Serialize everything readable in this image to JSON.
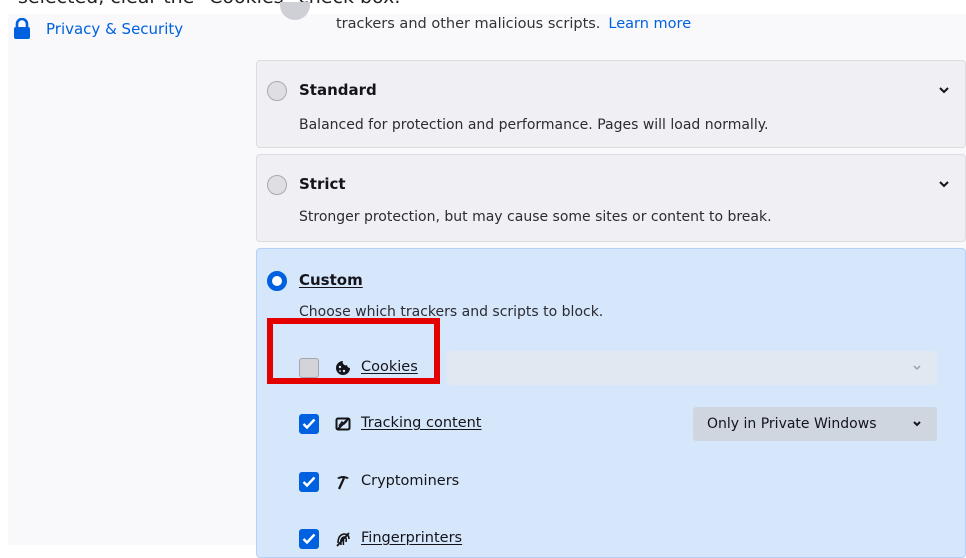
{
  "caption": "selected, clear the \"Cookies\" check box.",
  "sidebar": {
    "items": [
      {
        "label": "Privacy & Security",
        "icon": "lock-icon"
      }
    ]
  },
  "intro": {
    "text": "trackers and other malicious scripts.",
    "link": "Learn more"
  },
  "options": {
    "standard": {
      "title": "Standard",
      "description": "Balanced for protection and performance. Pages will load normally.",
      "checked": false
    },
    "strict": {
      "title": "Strict",
      "description": "Stronger protection, but may cause some sites or content to break.",
      "checked": false
    },
    "custom": {
      "title": "Custom",
      "description": "Choose which trackers and scripts to block.",
      "checked": true
    }
  },
  "custom_items": {
    "cookies": {
      "label": "Cookies",
      "checked": false,
      "icon": "cookie-icon"
    },
    "tracking": {
      "label": "Tracking content",
      "checked": true,
      "icon": "tracking-icon",
      "select_value": "Only in Private Windows"
    },
    "cryptominers": {
      "label": "Cryptominers",
      "checked": true,
      "icon": "cryptominer-icon"
    },
    "fingerprinters": {
      "label": "Fingerprinters",
      "checked": true,
      "icon": "fingerprint-icon"
    }
  },
  "colors": {
    "accent": "#0061e0",
    "highlight": "#e50000",
    "custom_bg": "#d6e7fb"
  }
}
